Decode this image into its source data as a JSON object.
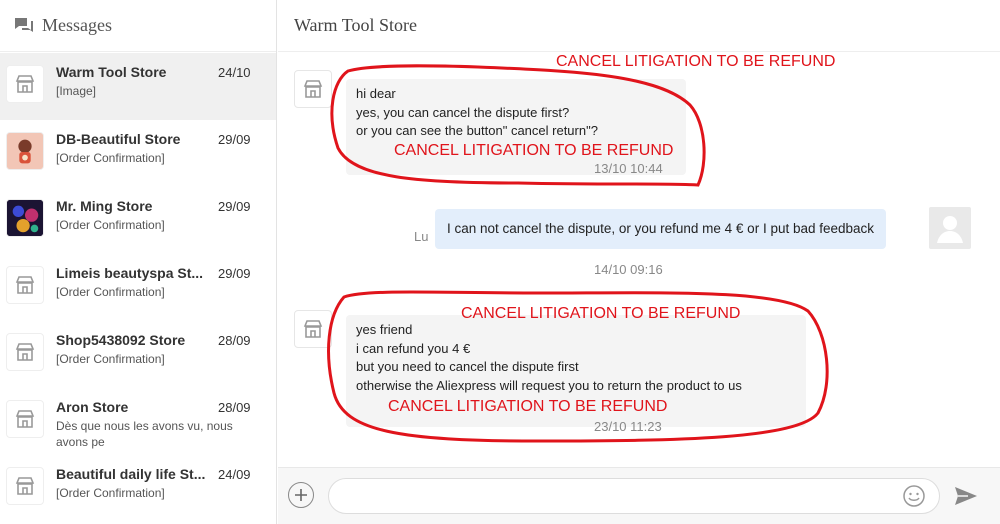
{
  "sidebar": {
    "title": "Messages",
    "conversations": [
      {
        "name": "Warm Tool Store",
        "date": "24/10",
        "preview": "[Image]"
      },
      {
        "name": "DB-Beautiful Store",
        "date": "29/09",
        "preview": "[Order Confirmation]"
      },
      {
        "name": "Mr. Ming Store",
        "date": "29/09",
        "preview": "[Order Confirmation]"
      },
      {
        "name": "Limeis beautyspa St...",
        "date": "29/09",
        "preview": "[Order Confirmation]"
      },
      {
        "name": "Shop5438092 Store",
        "date": "28/09",
        "preview": "[Order Confirmation]"
      },
      {
        "name": "Aron Store",
        "date": "28/09",
        "preview": "Dès que nous les avons vu, nous avons pe"
      },
      {
        "name": "Beautiful daily life St...",
        "date": "24/09",
        "preview": "[Order Confirmation]"
      }
    ]
  },
  "chat": {
    "title": "Warm Tool Store",
    "messages": [
      {
        "lines": [
          "hi dear",
          "yes, you can cancel the dispute first?",
          "or you can see the button\" cancel return\"?"
        ],
        "time": "13/10 10:44"
      },
      {
        "sender": "Lu",
        "text": "I can not cancel the dispute, or you refund me 4 € or I put bad feedback"
      },
      {
        "time": "14/10 09:16"
      },
      {
        "lines": [
          "yes friend",
          "i can refund you 4 €",
          "but you need to cancel the dispute first",
          "otherwise the Aliexpress will request you to return the product to us"
        ],
        "time": "23/10 11:23"
      }
    ],
    "annotation_text": "CANCEL LITIGATION TO BE REFUND",
    "annotation_color": "#e0141b"
  },
  "composer": {
    "input_value": "",
    "input_placeholder": ""
  },
  "colors": {
    "active_row": "#f0f0f0",
    "outgoing_bubble": "#e3eefb",
    "incoming_bubble": "#f4f4f4"
  },
  "icons": {
    "header": "chat-bubbles-icon",
    "store_avatar": "store-icon",
    "user_avatar": "user-silhouette-icon",
    "add": "plus-icon",
    "emoji": "smiley-icon",
    "send": "send-arrow-icon"
  }
}
